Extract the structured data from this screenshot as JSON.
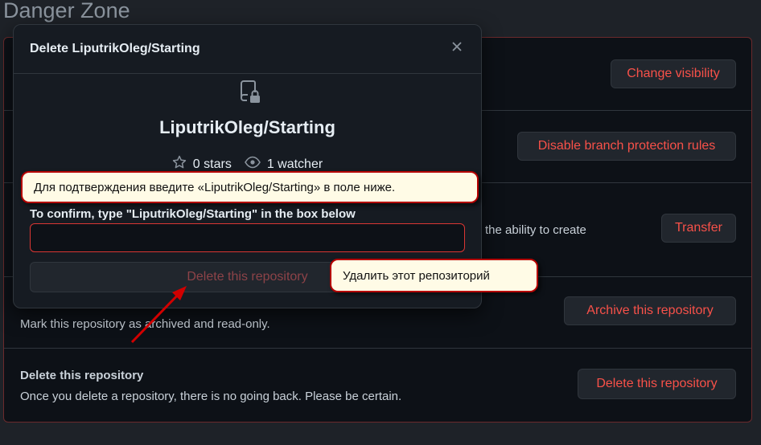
{
  "page": {
    "section_title": "Danger Zone"
  },
  "rows": {
    "visibility": {
      "button": "Change visibility"
    },
    "branch": {
      "button": "Disable branch protection rules"
    },
    "transfer": {
      "desc_partial": "the ability to create",
      "button": "Transfer"
    },
    "archive": {
      "desc": "Mark this repository as archived and read-only.",
      "button": "Archive this repository"
    },
    "delete": {
      "title": "Delete this repository",
      "desc": "Once you delete a repository, there is no going back. Please be certain.",
      "button": "Delete this repository"
    }
  },
  "modal": {
    "title": "Delete LiputrikOleg/Starting",
    "close_icon": "close-icon",
    "repo_icon": "repo-locked-icon",
    "repo_name": "LiputrikOleg/Starting",
    "stars": "0 stars",
    "watchers": "1 watcher",
    "confirm_label": "To confirm, type \"LiputrikOleg/Starting\" in the box below",
    "input_value": "",
    "delete_button": "Delete this repository"
  },
  "annotations": {
    "confirm_hint": "Для подтверждения введите «LiputrikOleg/Starting» в поле ниже.",
    "delete_hint": "Удалить этот репозиторий"
  },
  "colors": {
    "danger": "#f85149",
    "callout_bg": "#fffbe6",
    "callout_border": "#b40000",
    "arrow": "#d10000"
  }
}
